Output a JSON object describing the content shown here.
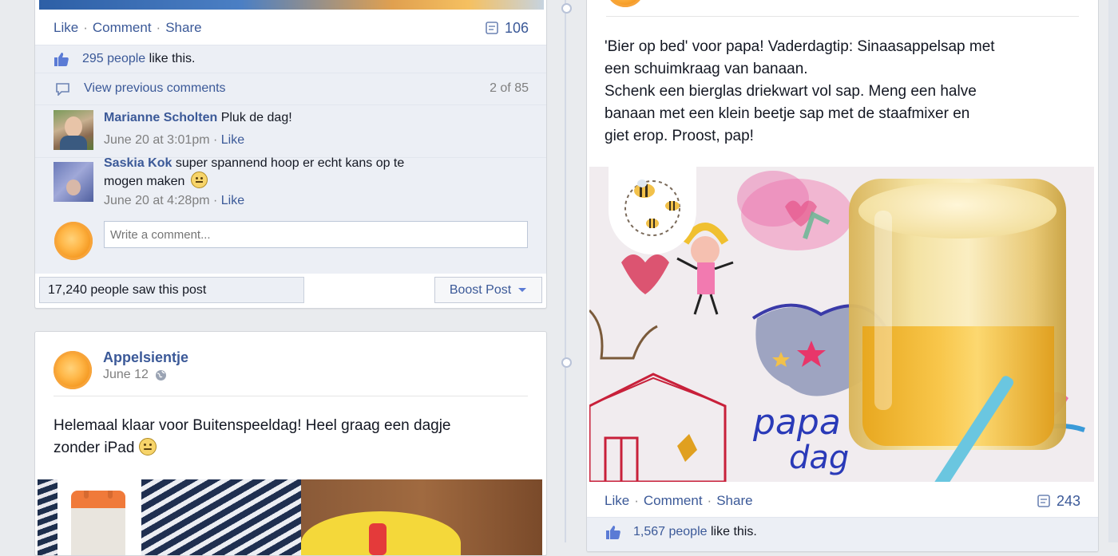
{
  "actions": {
    "like": "Like",
    "comment": "Comment",
    "share": "Share",
    "sep": "·"
  },
  "left_top_post": {
    "comment_count": "106",
    "likes_count": "295 people",
    "likes_suffix": "like this.",
    "view_previous": "View previous comments",
    "pager": "2 of 85",
    "comments": [
      {
        "author": "Marianne Scholten",
        "text": "Pluk de dag!",
        "time": "June 20 at 3:01pm",
        "like": "Like"
      },
      {
        "author": "Saskia Kok",
        "text_line1": "super spannend hoop er echt kans op te",
        "text_line2": "mogen maken",
        "time": "June 20 at 4:28pm",
        "like": "Like"
      }
    ],
    "comment_placeholder": "Write a comment...",
    "reach": "17,240 people saw this post",
    "boost_label": "Boost Post"
  },
  "left_bottom_post": {
    "author": "Appelsientje",
    "date": "June 12",
    "text_line1": "Helemaal klaar voor Buitenspeeldag! Heel graag een dagje",
    "text_line2": "zonder iPad"
  },
  "right_post": {
    "text_lines": [
      "'Bier op bed' voor papa! Vaderdagtip: Sinaasappelsap met",
      "een schuimkraag van banaan.",
      "Schenk een bierglas driekwart vol sap. Meng een halve",
      "banaan met een klein beetje sap met de staafmixer en",
      "giet erop. Proost, pap!"
    ],
    "drawing_text_1": "papa",
    "drawing_text_2": "dag",
    "comment_count": "243",
    "likes_count": "1,567 people",
    "likes_suffix": "like this."
  },
  "colors": {
    "fb_blue": "#3b5998",
    "ufi_bg": "#eceff5",
    "page_bg": "#e9ebee"
  },
  "icons": [
    "thumbs-up-icon",
    "comment-bubble-icon",
    "comment-count-icon",
    "globe-icon",
    "chevron-down-icon",
    "smiley-icon",
    "bee-icon"
  ]
}
